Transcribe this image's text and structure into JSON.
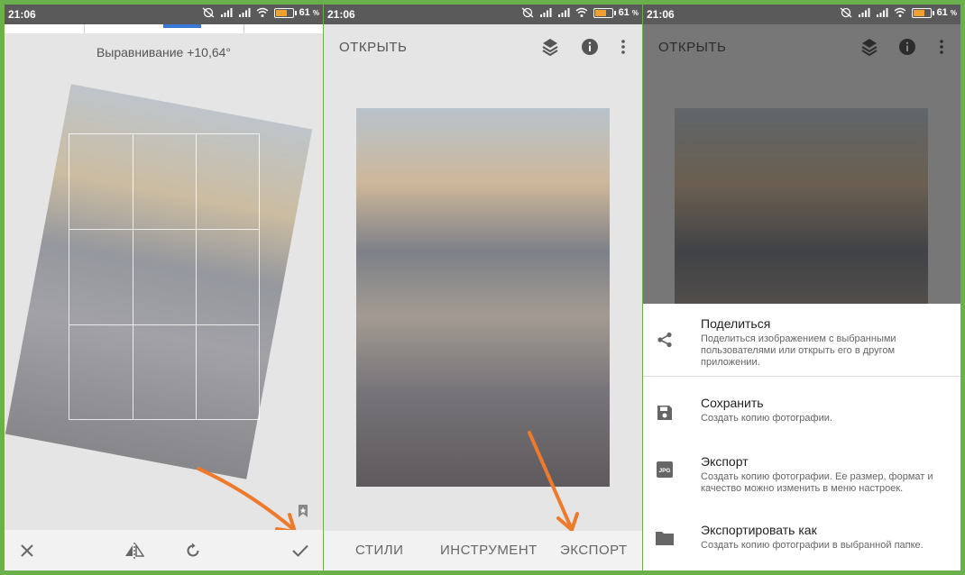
{
  "status_bar": {
    "time": "21:06",
    "battery_percent": "61",
    "battery_suffix": "%",
    "battery_level": 0.61
  },
  "panel1": {
    "straighten_label": "Выравнивание +10,64°",
    "icons": [
      "close-icon",
      "flip-icon",
      "rotate-icon",
      "check-icon",
      "bookmark-icon"
    ]
  },
  "panel2": {
    "open_label": "ОТКРЫТЬ",
    "icons": [
      "layers-icon",
      "info-icon",
      "more-vert-icon"
    ],
    "tabs": [
      "СТИЛИ",
      "ИНСТРУМЕНТ",
      "ЭКСПОРТ"
    ]
  },
  "panel3": {
    "open_label": "ОТКРЫТЬ",
    "sheet": [
      {
        "title": "Поделиться",
        "description": "Поделиться изображением с выбранными пользователями или открыть его в другом приложении.",
        "icon": "share-icon"
      },
      {
        "title": "Сохранить",
        "description": "Создать копию фотографии.",
        "icon": "save-icon"
      },
      {
        "title": "Экспорт",
        "description": "Создать копию фотографии. Ее размер, формат и качество можно изменить в меню настроек.",
        "icon": "jpg-icon",
        "icon_label": "JPG"
      },
      {
        "title": "Экспортировать как",
        "description": "Создать копию фотографии в выбранной папке.",
        "icon": "folder-icon"
      }
    ]
  },
  "colors": {
    "accent": "#3a78d8",
    "annotation_arrow": "#f07a2c",
    "frame": "#6ab04c"
  }
}
